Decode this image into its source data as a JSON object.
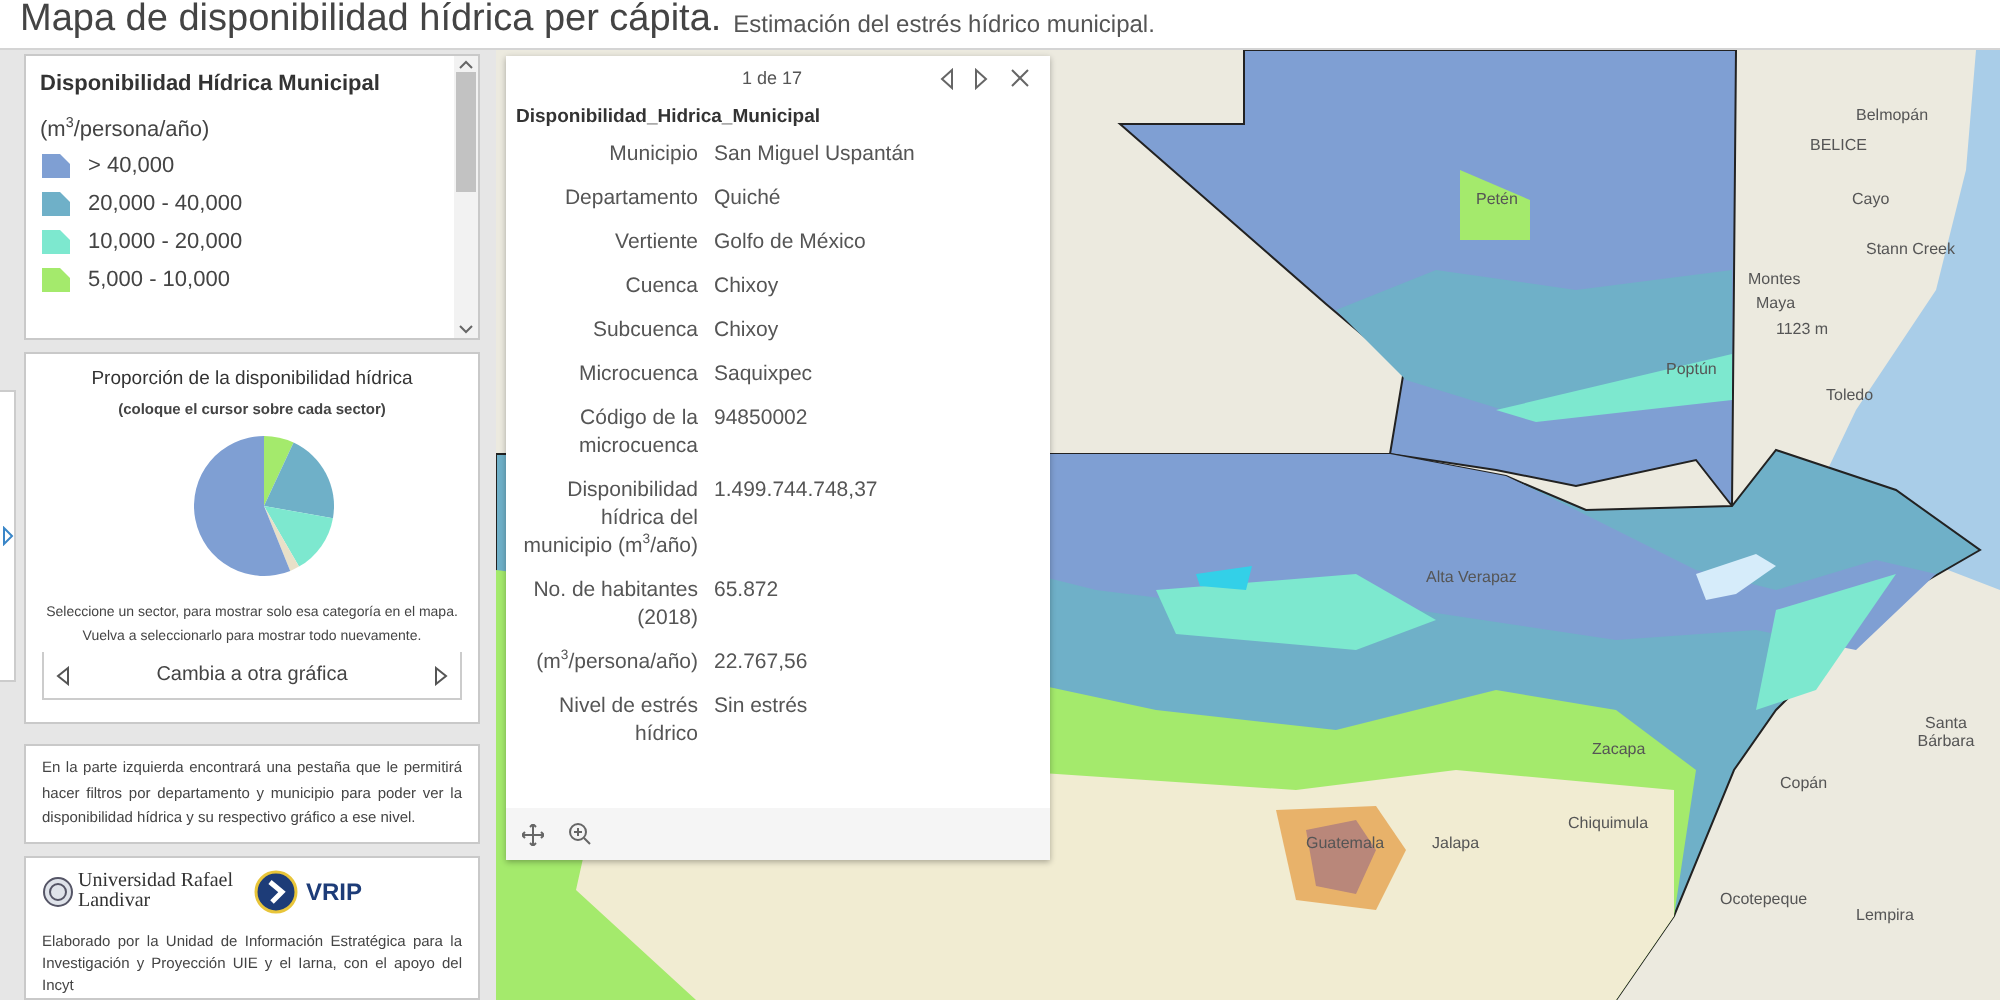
{
  "header": {
    "title": "Mapa de disponibilidad hídrica per cápita.",
    "subtitle": "Estimación del estrés hídrico municipal."
  },
  "legend": {
    "title": "Disponibilidad Hídrica Municipal",
    "unit": "(m$^{3}$/persona/año)",
    "items": [
      {
        "label": "> 40,000",
        "color": "#7f9fd3"
      },
      {
        "label": "20,000 - 40,000",
        "color": "#6fb0c8"
      },
      {
        "label": "10,000 - 20,000",
        "color": "#7de8cf"
      },
      {
        "label": "5,000 - 10,000",
        "color": "#a4ea6c"
      }
    ]
  },
  "chart_panel": {
    "title": "Proporción de la disponibilidad hídrica",
    "hint": "(coloque el cursor sobre cada sector)",
    "note_1": "Seleccione un sector, para mostrar solo esa categoría en el mapa.",
    "note_2": "Vuelva a seleccionarlo para mostrar todo nuevamente.",
    "switch_label": "Cambia a otra gráfica"
  },
  "info_text": "En la parte izquierda encontrará una pestaña que le permitirá hacer filtros por departamento y municipio para poder ver la disponibilidad hídrica y su respectivo gráfico a ese nivel.",
  "credits": {
    "university": "Universidad Rafael Landivar",
    "vrip": "VRIP",
    "text": "Elaborado por la Unidad de Información Estratégica para la Investigación y Proyección UIE y el Iarna, con el apoyo del Incyt"
  },
  "popup": {
    "pager": "1 de 17",
    "layer": "Disponibilidad_Hidrica_Municipal",
    "fields": [
      {
        "label": "Municipio",
        "value": "San Miguel Uspantán"
      },
      {
        "label": "Departamento",
        "value": "Quiché"
      },
      {
        "label": "Vertiente",
        "value": "Golfo de México"
      },
      {
        "label": "Cuenca",
        "value": "Chixoy"
      },
      {
        "label": "Subcuenca",
        "value": "Chixoy"
      },
      {
        "label": "Microcuenca",
        "value": "Saquixpec"
      },
      {
        "label": "Código de la microcuenca",
        "value": "94850002"
      },
      {
        "label": "Disponibilidad hídrica del municipio (m$^{3}$/año)",
        "value": "1.499.744.748,37"
      },
      {
        "label": "No. de habitantes (2018)",
        "value": "65.872"
      },
      {
        "label": "(m$^{3}$/persona/año)",
        "value": "22.767,56"
      },
      {
        "label": "Nivel de estrés hídrico",
        "value": "Sin estrés"
      }
    ]
  },
  "map": {
    "labels": [
      "Belmopán",
      "BELICE",
      "Cayo",
      "Stann Creek",
      "Montes",
      "Maya",
      "1123 m",
      "Toledo",
      "Petén",
      "Poptún",
      "Alta Verapaz",
      "Santa Bárbara",
      "Copán",
      "Ocotepeque",
      "Lempira",
      "Zacapa",
      "Chiquimula",
      "Jalapa",
      "Guatemala"
    ]
  }
}
